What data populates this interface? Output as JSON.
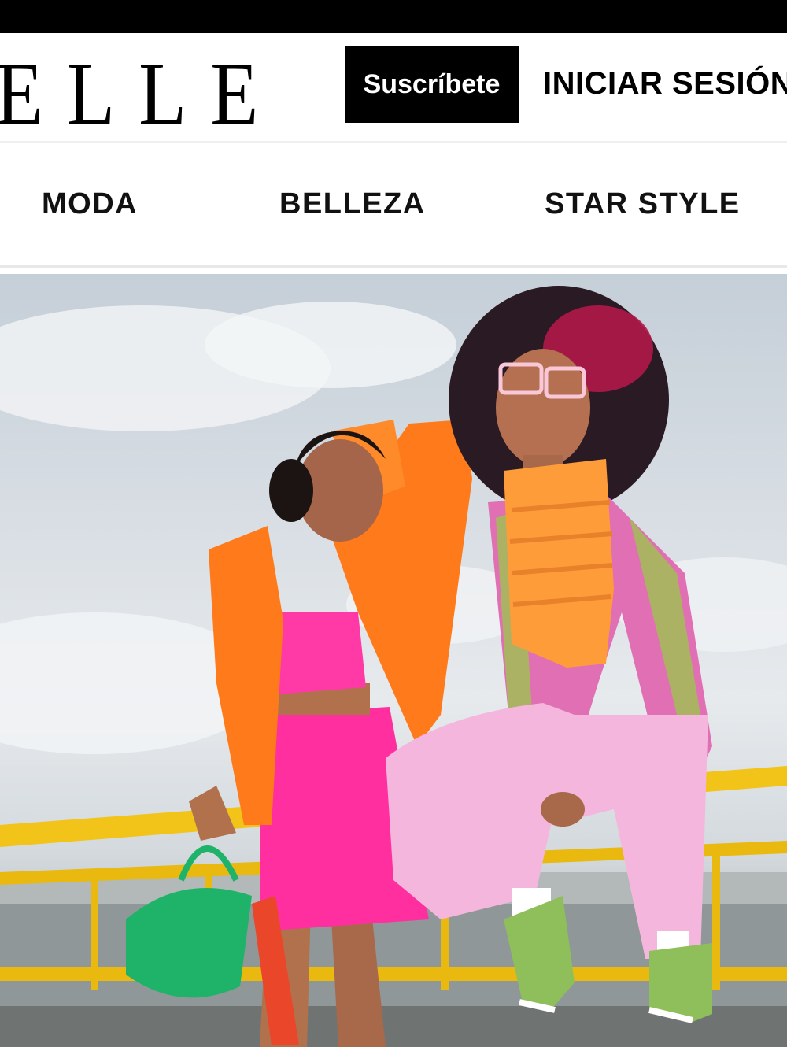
{
  "header": {
    "logo_text": "ELLE",
    "subscribe_label": "Suscríbete",
    "login_label": "INICIAR SESIÓN"
  },
  "nav": {
    "items": [
      {
        "label": "MODA"
      },
      {
        "label": "BELLEZA"
      },
      {
        "label": "STAR STYLE"
      }
    ]
  },
  "hero": {
    "icon": "fashion-photo",
    "colors": {
      "sky": "#d7dde3",
      "railing": "#f2c318",
      "cardigan": "#ff7a1a",
      "skirt": "#ff2fa0",
      "pants": "#f4b6dc",
      "bag": "#1fb36a",
      "sneakers": "#8fbf5a"
    }
  }
}
